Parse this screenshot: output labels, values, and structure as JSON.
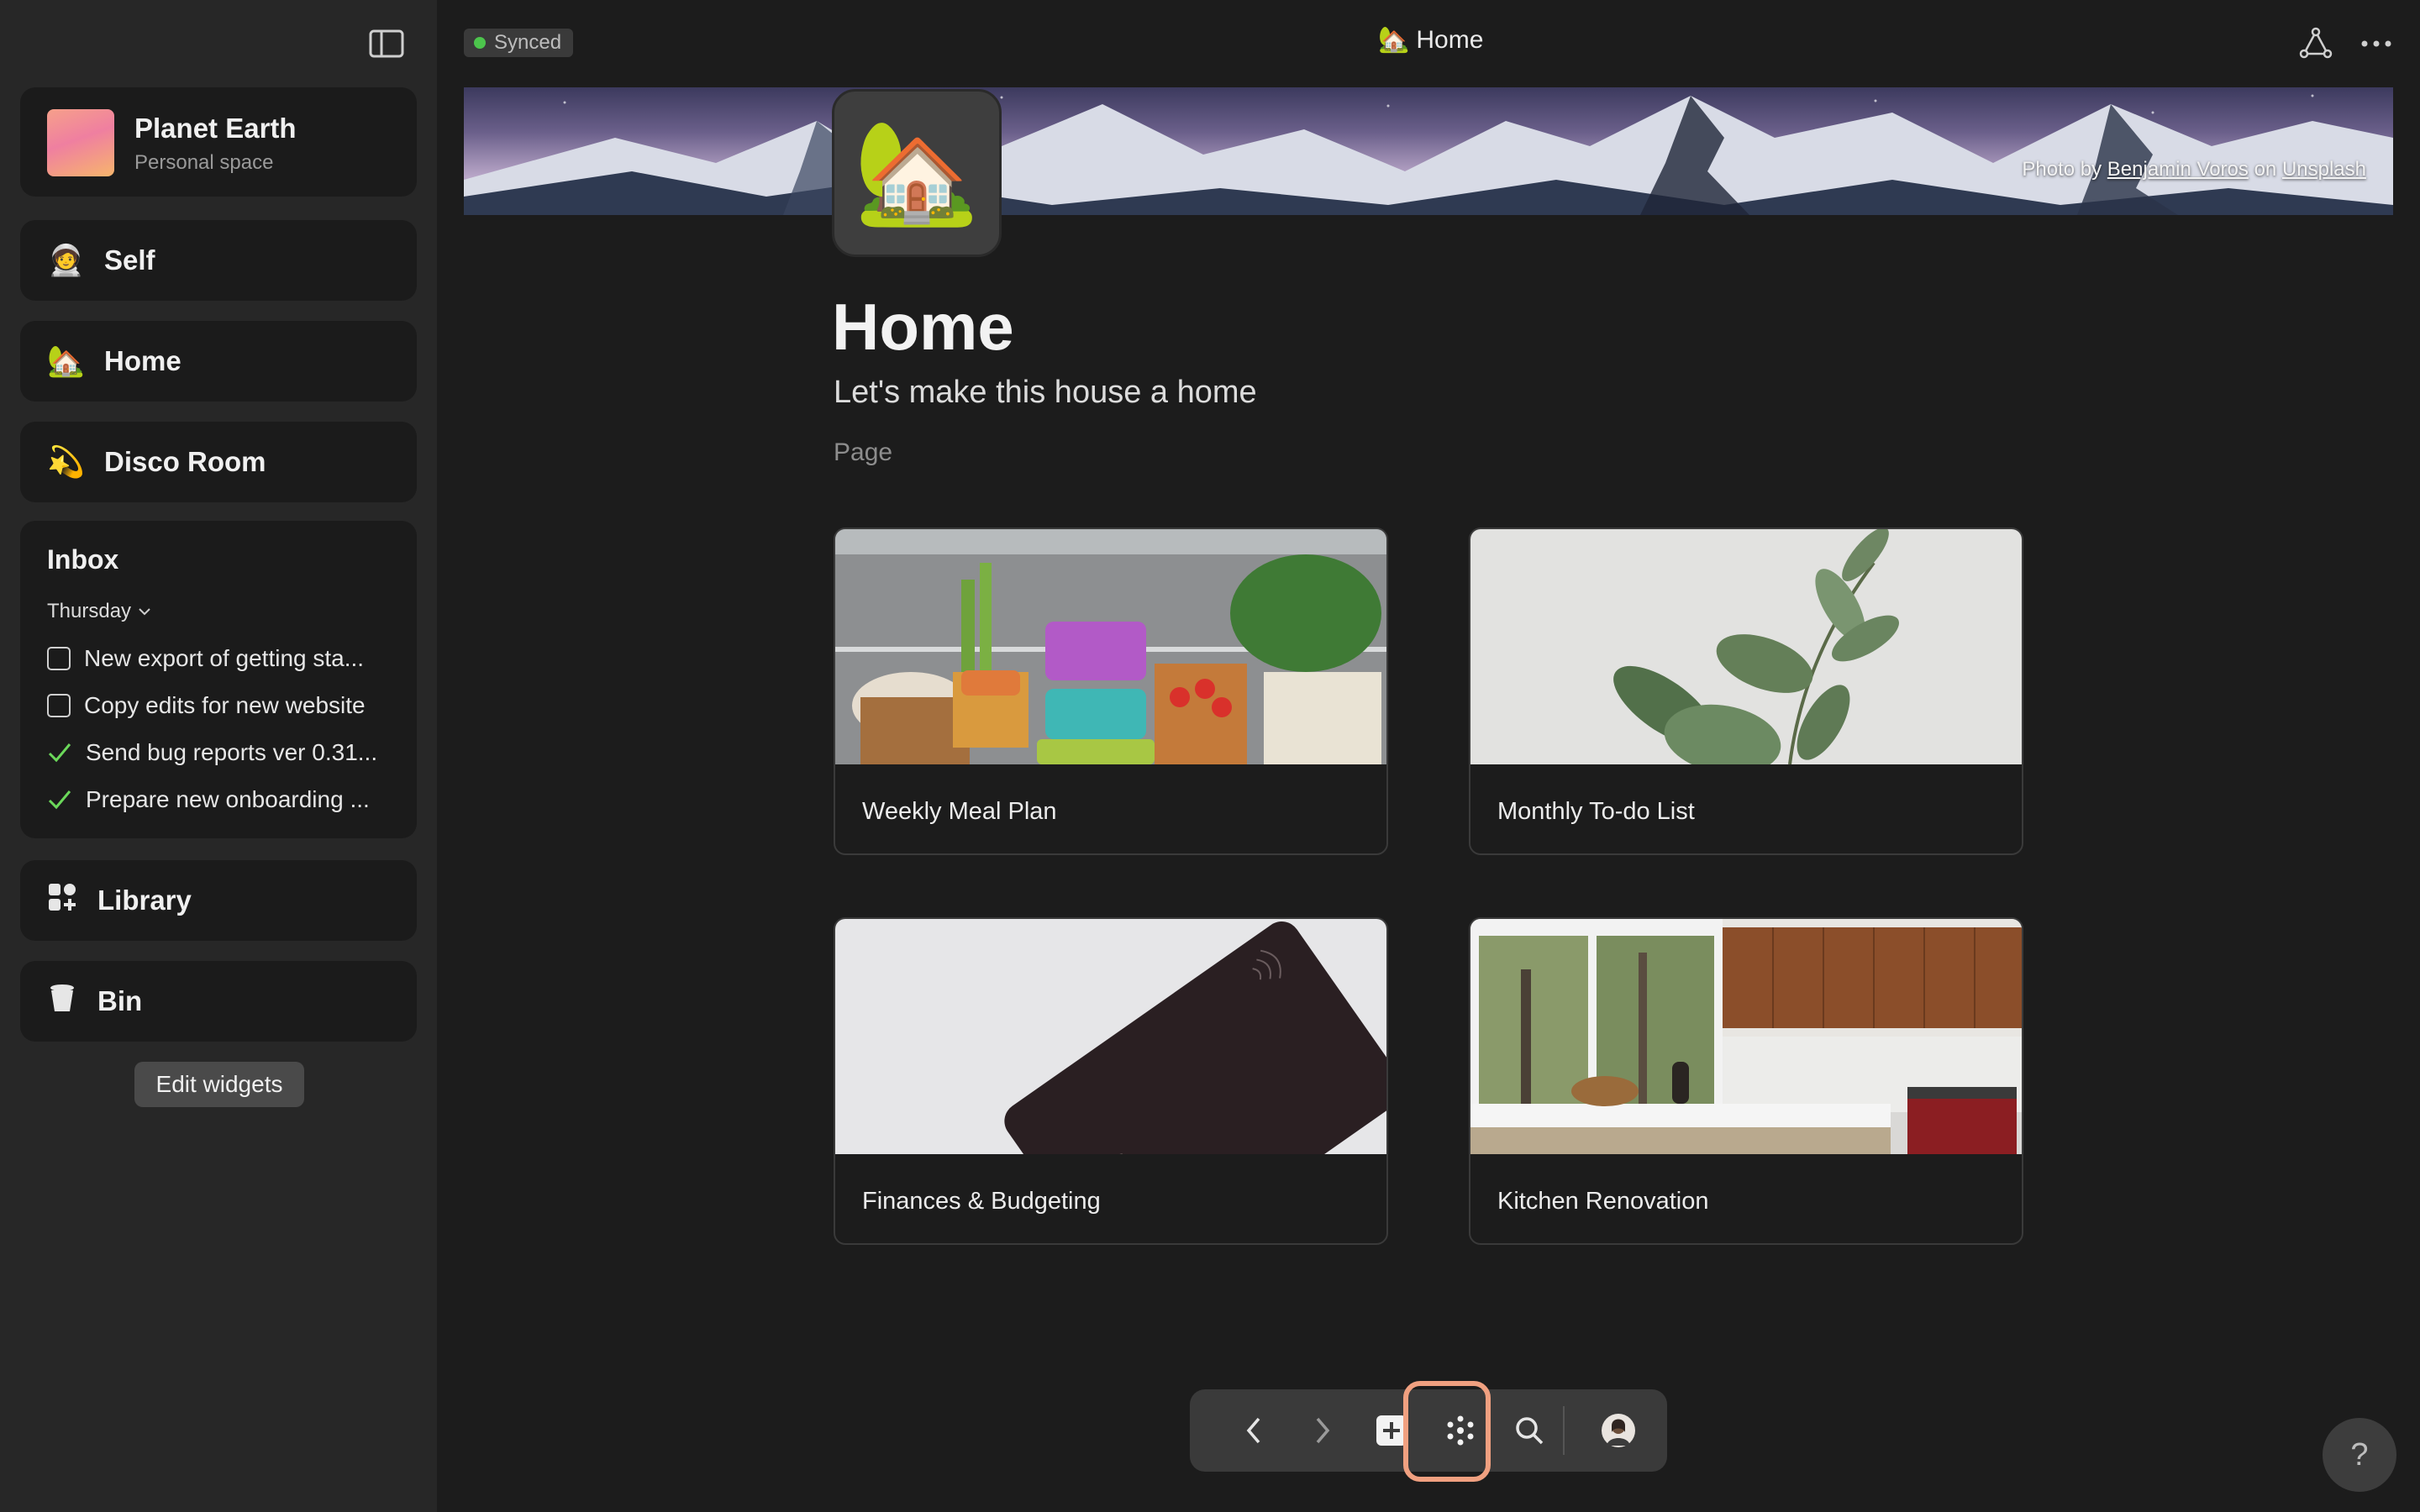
{
  "sidebar": {
    "toggle_icon": "sidebar-toggle-icon",
    "space": {
      "name": "Planet Earth",
      "subtitle": "Personal space"
    },
    "nav": [
      {
        "emoji": "🧑‍🚀",
        "label": "Self"
      },
      {
        "emoji": "🏡",
        "label": "Home"
      },
      {
        "emoji": "💫",
        "label": "Disco Room"
      }
    ],
    "inbox": {
      "title": "Inbox",
      "day": "Thursday",
      "items": [
        {
          "text": "New export of getting sta...",
          "done": false
        },
        {
          "text": "Copy edits for new website",
          "done": false
        },
        {
          "text": "Send bug reports ver 0.31...",
          "done": true
        },
        {
          "text": "Prepare new onboarding ...",
          "done": true
        }
      ]
    },
    "library": {
      "label": "Library",
      "icon": "library-icon"
    },
    "bin": {
      "label": "Bin",
      "icon": "bin-icon"
    },
    "edit_widgets": "Edit widgets"
  },
  "topbar": {
    "sync_status": "Synced",
    "title_emoji": "🏡",
    "title": "Home"
  },
  "banner": {
    "credit_prefix": "Photo by",
    "credit_author": "Benjamin Voros",
    "credit_on": "on",
    "credit_source": "Unsplash"
  },
  "page": {
    "icon": "🏡",
    "title": "Home",
    "subtitle": "Let's make this house a home",
    "type": "Page"
  },
  "tiles": [
    {
      "label": "Weekly Meal Plan"
    },
    {
      "label": "Monthly To-do List"
    },
    {
      "label": "Finances & Budgeting"
    },
    {
      "label": "Kitchen Renovation"
    }
  ],
  "help_label": "?",
  "colors": {
    "accent_highlight": "#f0a080",
    "sync_green": "#4cc44c",
    "check_green": "#6bd85a"
  }
}
